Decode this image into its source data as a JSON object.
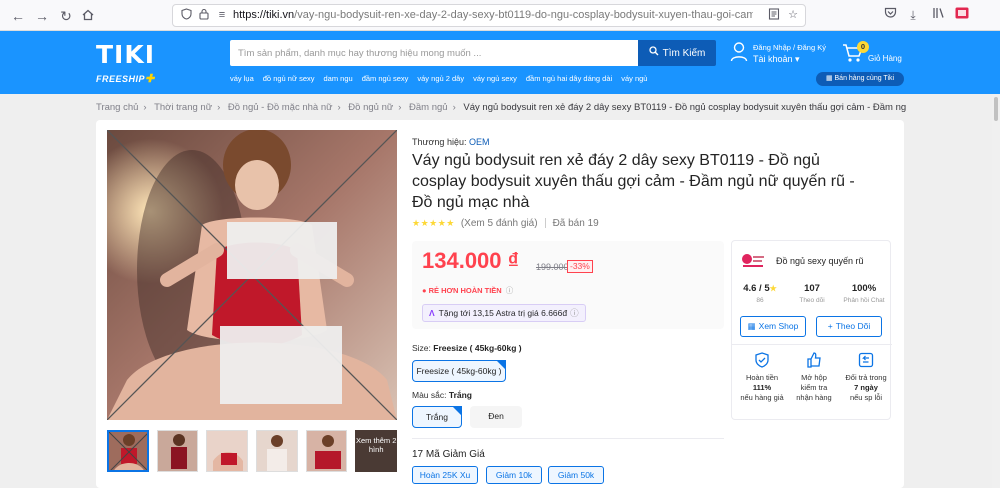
{
  "browser": {
    "url_host": "https://tiki.vn",
    "url_path": "/vay-ngu-bodysuit-ren-xe-day-2-day-sexy-bt0119-do-ngu-cosplay-bodysuit-xuyen-thau-goi-cam-dam-ngu-nu-quyen-r"
  },
  "header": {
    "logo": "TIKI",
    "freeship": "FREESHIP",
    "search_placeholder": "Tìm sản phẩm, danh mục hay thương hiệu mong muốn ...",
    "search_button": "Tìm Kiếm",
    "quick_links": [
      "váy lụa",
      "đồ ngủ nữ sexy",
      "dam ngu",
      "đầm ngủ sexy",
      "váy ngủ 2 dây",
      "váy ngủ sexy",
      "đầm ngủ hai dây dáng dài",
      "váy ngủ"
    ],
    "account_line1": "Đăng Nhập / Đăng Ký",
    "account_line2": "Tài khoản",
    "cart_count": "0",
    "cart_label": "Giỏ Hàng",
    "sell_button": "Bán hàng cùng Tiki",
    "brand_color": "#1a94ff"
  },
  "breadcrumb": [
    "Trang chủ",
    "Thời trang nữ",
    "Đồ ngủ - Đồ mặc nhà nữ",
    "Đồ ngủ nữ",
    "Đầm ngủ",
    "Váy ngủ bodysuit ren xẻ đáy 2 dây sexy BT0119 - Đồ ngủ cosplay bodysuit xuyên thấu gợi cảm - Đầm ngủ nữ quyến rũ - Đồ ngủ mặc nhà"
  ],
  "gallery": {
    "more_label": "Xem thêm 2 hình"
  },
  "product": {
    "brand_label": "Thương hiệu: ",
    "brand": "OEM",
    "title": "Váy ngủ bodysuit ren xẻ đáy 2 dây sexy BT0119 - Đồ ngủ cosplay bodysuit xuyên thấu gợi cảm - Đầm ngủ nữ quyến rũ - Đồ ngủ mạc nhà",
    "stars": "★★★★★",
    "reviews": "(Xem 5 đánh giá)",
    "sold": "Đã bán 19",
    "price": "134.000 ₫",
    "price_old": "199.000 ₫",
    "discount": "-33%",
    "refund": "RẺ HƠN HOÀN TIỀN",
    "astra": "Tặng tới 13,15 Astra trị giá 6.666đ",
    "size_label": "Size: ",
    "size_value": "Freesize ( 45kg-60kg )",
    "size_options": [
      "Freesize ( 45kg-60kg )"
    ],
    "color_label": "Màu sắc: ",
    "color_value": "Trắng",
    "color_options": [
      "Trắng",
      "Đen"
    ],
    "coupon_title": "17 Mã Giảm Giá",
    "coupons": [
      "Hoàn 25K Xu",
      "Giảm 10k",
      "Giảm 50k"
    ],
    "price_color": "#ff424e"
  },
  "seller": {
    "name": "Đồ ngủ sexy quyến rũ",
    "rating": "4.6 / 5",
    "rating_count": "86",
    "followers": "107",
    "followers_label": "Theo dõi",
    "response": "100%",
    "response_label": "Phản hồi Chat",
    "view_shop": "Xem Shop",
    "follow": "Theo Dõi",
    "policies": [
      {
        "line1": "Hoàn tiền",
        "line2": "111%",
        "line3": "nếu hàng giả"
      },
      {
        "line1": "Mở hộp",
        "line2": "kiểm tra",
        "line3": "nhận hàng"
      },
      {
        "line1": "Đổi trả trong",
        "line2": "7 ngày",
        "line3": "nếu sp lỗi"
      }
    ]
  }
}
